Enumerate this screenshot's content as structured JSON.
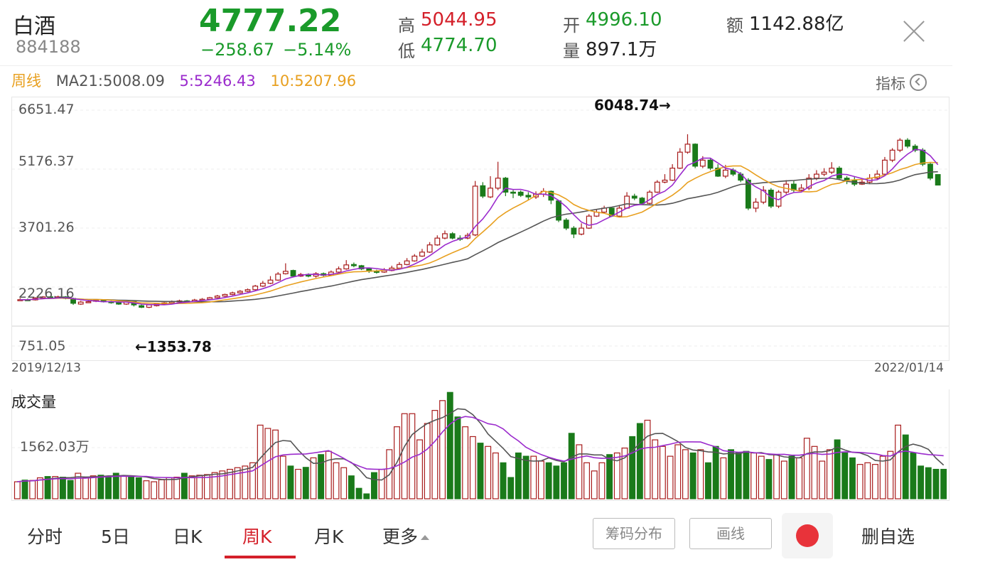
{
  "header": {
    "name": "白酒",
    "code": "884188",
    "price": "4777.22",
    "change": "−258.67",
    "change_pct": "−5.14%",
    "high_label": "高",
    "high": "5044.95",
    "low_label": "低",
    "low": "4774.70",
    "open_label": "开",
    "open": "4996.10",
    "volume_label": "量",
    "volume": "897.1万",
    "amount_label": "额",
    "amount": "1142.88亿"
  },
  "ma_bar": {
    "period": "周线",
    "ma21": "MA21:5008.09",
    "ma5": "5:5246.43",
    "ma10": "10:5207.96"
  },
  "indicator_label": "指标",
  "chart_data": {
    "type": "candlestick",
    "y_ticks": [
      "6651.47",
      "5176.37",
      "3701.26",
      "2226.16",
      "751.05"
    ],
    "ylim": [
      751.05,
      6651.47
    ],
    "start_date": "2019/12/13",
    "end_date": "2022/01/14",
    "max_annotation": "6048.74→",
    "min_annotation": "←1353.78",
    "max_value": 6048.74,
    "min_value": 1353.78,
    "volume_title": "成交量",
    "volume_tick": "1562.03万",
    "candles": [
      [
        1900,
        1910,
        1950,
        1880
      ],
      [
        1910,
        1905,
        1940,
        1880
      ],
      [
        1905,
        1950,
        1970,
        1890
      ],
      [
        1950,
        1980,
        2000,
        1940
      ],
      [
        1980,
        1960,
        2000,
        1940
      ],
      [
        1960,
        1980,
        2010,
        1950
      ],
      [
        1980,
        1940,
        2000,
        1920
      ],
      [
        1940,
        1820,
        1960,
        1780
      ],
      [
        1800,
        1850,
        1880,
        1780
      ],
      [
        1850,
        1860,
        1890,
        1830
      ],
      [
        1870,
        1900,
        1920,
        1850
      ],
      [
        1900,
        1860,
        1920,
        1840
      ],
      [
        1860,
        1840,
        1880,
        1810
      ],
      [
        1850,
        1800,
        1880,
        1780
      ],
      [
        1800,
        1860,
        1880,
        1780
      ],
      [
        1860,
        1780,
        1870,
        1740
      ],
      [
        1760,
        1720,
        1800,
        1700
      ],
      [
        1720,
        1780,
        1800,
        1700
      ],
      [
        1760,
        1800,
        1820,
        1740
      ],
      [
        1800,
        1830,
        1850,
        1780
      ],
      [
        1830,
        1860,
        1890,
        1810
      ],
      [
        1860,
        1880,
        1910,
        1840
      ],
      [
        1880,
        1870,
        1900,
        1850
      ],
      [
        1870,
        1900,
        1930,
        1850
      ],
      [
        1900,
        1920,
        1950,
        1880
      ],
      [
        1920,
        1960,
        1980,
        1900
      ],
      [
        1960,
        2000,
        2030,
        1940
      ],
      [
        2000,
        2040,
        2060,
        1980
      ],
      [
        2040,
        2080,
        2110,
        2020
      ],
      [
        2080,
        2120,
        2150,
        2060
      ],
      [
        2120,
        2160,
        2190,
        2100
      ],
      [
        2160,
        2250,
        2280,
        2140
      ],
      [
        2250,
        2320,
        2380,
        2230
      ],
      [
        2320,
        2400,
        2500,
        2300
      ],
      [
        2400,
        2550,
        2600,
        2380
      ],
      [
        2560,
        2620,
        2820,
        2540
      ],
      [
        2640,
        2500,
        2660,
        2470
      ],
      [
        2500,
        2540,
        2580,
        2480
      ],
      [
        2540,
        2500,
        2570,
        2470
      ],
      [
        2500,
        2560,
        2600,
        2460
      ],
      [
        2560,
        2520,
        2590,
        2490
      ],
      [
        2520,
        2600,
        2640,
        2500
      ],
      [
        2600,
        2680,
        2740,
        2580
      ],
      [
        2680,
        2780,
        2900,
        2660
      ],
      [
        2790,
        2760,
        2840,
        2720
      ],
      [
        2760,
        2680,
        2780,
        2650
      ],
      [
        2680,
        2620,
        2700,
        2580
      ],
      [
        2620,
        2600,
        2660,
        2560
      ],
      [
        2600,
        2640,
        2700,
        2580
      ],
      [
        2640,
        2700,
        2760,
        2620
      ],
      [
        2700,
        2790,
        2850,
        2680
      ],
      [
        2790,
        2880,
        2950,
        2770
      ],
      [
        2880,
        3000,
        3050,
        2860
      ],
      [
        3000,
        3100,
        3180,
        2980
      ],
      [
        3100,
        3280,
        3350,
        3080
      ],
      [
        3280,
        3450,
        3520,
        3260
      ],
      [
        3450,
        3560,
        3640,
        3420
      ],
      [
        3560,
        3450,
        3600,
        3420
      ],
      [
        3450,
        3420,
        3520,
        3380
      ],
      [
        3450,
        3520,
        3580,
        3420
      ],
      [
        3530,
        4750,
        4880,
        3500
      ],
      [
        4760,
        4500,
        4850,
        4450
      ],
      [
        4480,
        4700,
        5000,
        4450
      ],
      [
        4700,
        4950,
        5360,
        4650
      ],
      [
        4950,
        4600,
        4980,
        4500
      ],
      [
        4600,
        4580,
        4650,
        4450
      ],
      [
        4600,
        4520,
        4640,
        4480
      ],
      [
        4520,
        4480,
        4600,
        4400
      ],
      [
        4480,
        4550,
        4620,
        4430
      ],
      [
        4550,
        4620,
        4700,
        4480
      ],
      [
        4620,
        4400,
        4640,
        4300
      ],
      [
        4380,
        3900,
        4400,
        3850
      ],
      [
        3900,
        3700,
        3950,
        3650
      ],
      [
        3700,
        3550,
        3750,
        3450
      ],
      [
        3550,
        3700,
        3820,
        3520
      ],
      [
        3700,
        4000,
        4050,
        3680
      ],
      [
        4000,
        4100,
        4180,
        3980
      ],
      [
        4100,
        4200,
        4260,
        4060
      ],
      [
        4200,
        4000,
        4220,
        3980
      ],
      [
        4000,
        4200,
        4280,
        3980
      ],
      [
        4200,
        4500,
        4600,
        4180
      ],
      [
        4500,
        4450,
        4560,
        4400
      ],
      [
        4450,
        4320,
        4480,
        4280
      ],
      [
        4320,
        4600,
        4650,
        4300
      ],
      [
        4600,
        4850,
        4900,
        4580
      ],
      [
        4850,
        4900,
        5050,
        4820
      ],
      [
        4900,
        5200,
        5300,
        4880
      ],
      [
        5200,
        5600,
        5700,
        5180
      ],
      [
        5600,
        5800,
        6048.74,
        5560
      ],
      [
        5800,
        5250,
        5820,
        5200
      ],
      [
        5250,
        5400,
        5500,
        5200
      ],
      [
        5400,
        5200,
        5450,
        5150
      ],
      [
        5200,
        5000,
        5300,
        4980
      ],
      [
        5000,
        5150,
        5280,
        4950
      ],
      [
        5150,
        5050,
        5200,
        5000
      ],
      [
        5050,
        4900,
        5100,
        4850
      ],
      [
        4900,
        4200,
        4950,
        4150
      ],
      [
        4200,
        4350,
        4450,
        4100
      ],
      [
        4350,
        4650,
        4750,
        4300
      ],
      [
        4650,
        4250,
        4700,
        4200
      ],
      [
        4250,
        4600,
        4650,
        4200
      ],
      [
        4600,
        4800,
        4900,
        4550
      ],
      [
        4800,
        4650,
        4900,
        4600
      ],
      [
        4650,
        4700,
        4800,
        4600
      ],
      [
        4700,
        4950,
        5050,
        4650
      ],
      [
        4950,
        5050,
        5150,
        4900
      ],
      [
        5050,
        5100,
        5200,
        5000
      ],
      [
        5100,
        5200,
        5350,
        5050
      ],
      [
        5200,
        4950,
        5250,
        4900
      ],
      [
        4950,
        4900,
        5000,
        4800
      ],
      [
        4900,
        4800,
        4980,
        4750
      ],
      [
        4800,
        4850,
        4950,
        4780
      ],
      [
        4850,
        4950,
        5050,
        4800
      ],
      [
        4950,
        5050,
        5150,
        4900
      ],
      [
        5050,
        5400,
        5480,
        5000
      ],
      [
        5400,
        5650,
        5700,
        5350
      ],
      [
        5650,
        5900,
        5950,
        5600
      ],
      [
        5900,
        5750,
        5950,
        5700
      ],
      [
        5750,
        5650,
        5800,
        5600
      ],
      [
        5650,
        5300,
        5700,
        5250
      ],
      [
        5300,
        4950,
        5350,
        4900
      ],
      [
        5040,
        4777,
        5045,
        4775
      ]
    ],
    "volumes": [
      520,
      570,
      560,
      640,
      680,
      680,
      660,
      560,
      780,
      640,
      700,
      720,
      660,
      780,
      700,
      660,
      640,
      550,
      520,
      580,
      650,
      660,
      780,
      700,
      720,
      740,
      800,
      850,
      900,
      950,
      1000,
      1100,
      2250,
      2150,
      2100,
      1300,
      1000,
      900,
      960,
      1250,
      1350,
      1450,
      1100,
      950,
      700,
      320,
      150,
      800,
      900,
      1500,
      2200,
      2600,
      2600,
      1800,
      2300,
      2700,
      3000,
      3250,
      2500,
      2200,
      1900,
      1700,
      1600,
      1400,
      1100,
      650,
      1400,
      1300,
      1300,
      1150,
      1100,
      1000,
      1100,
      2000,
      1650,
      1100,
      850,
      1100,
      1350,
      1400,
      1550,
      1900,
      2300,
      2400,
      1800,
      1600,
      1300,
      1650,
      1500,
      1400,
      1500,
      1100,
      1600,
      1250,
      1500,
      1400,
      1450,
      1400,
      1300,
      1200,
      1350,
      1150,
      1300,
      1250,
      1850,
      1600,
      1150,
      1500,
      1800,
      1400,
      1250,
      1050,
      1100,
      1050,
      1300,
      1450,
      2250,
      1950,
      1400,
      1000,
      950,
      900,
      900
    ]
  },
  "tabs": [
    "分时",
    "5日",
    "日K",
    "周K",
    "月K",
    "更多"
  ],
  "active_tab": "周K",
  "buttons": {
    "chips": "筹码分布",
    "draw": "画线",
    "delete_watch": "删自选"
  },
  "colors": {
    "up": "#a81c1c",
    "down": "#1a7a1a",
    "ma5": "#9b2bcd",
    "ma10": "#e8a020",
    "ma21": "#555555",
    "accent": "#d4202a",
    "price_green": "#1a9a2a"
  }
}
